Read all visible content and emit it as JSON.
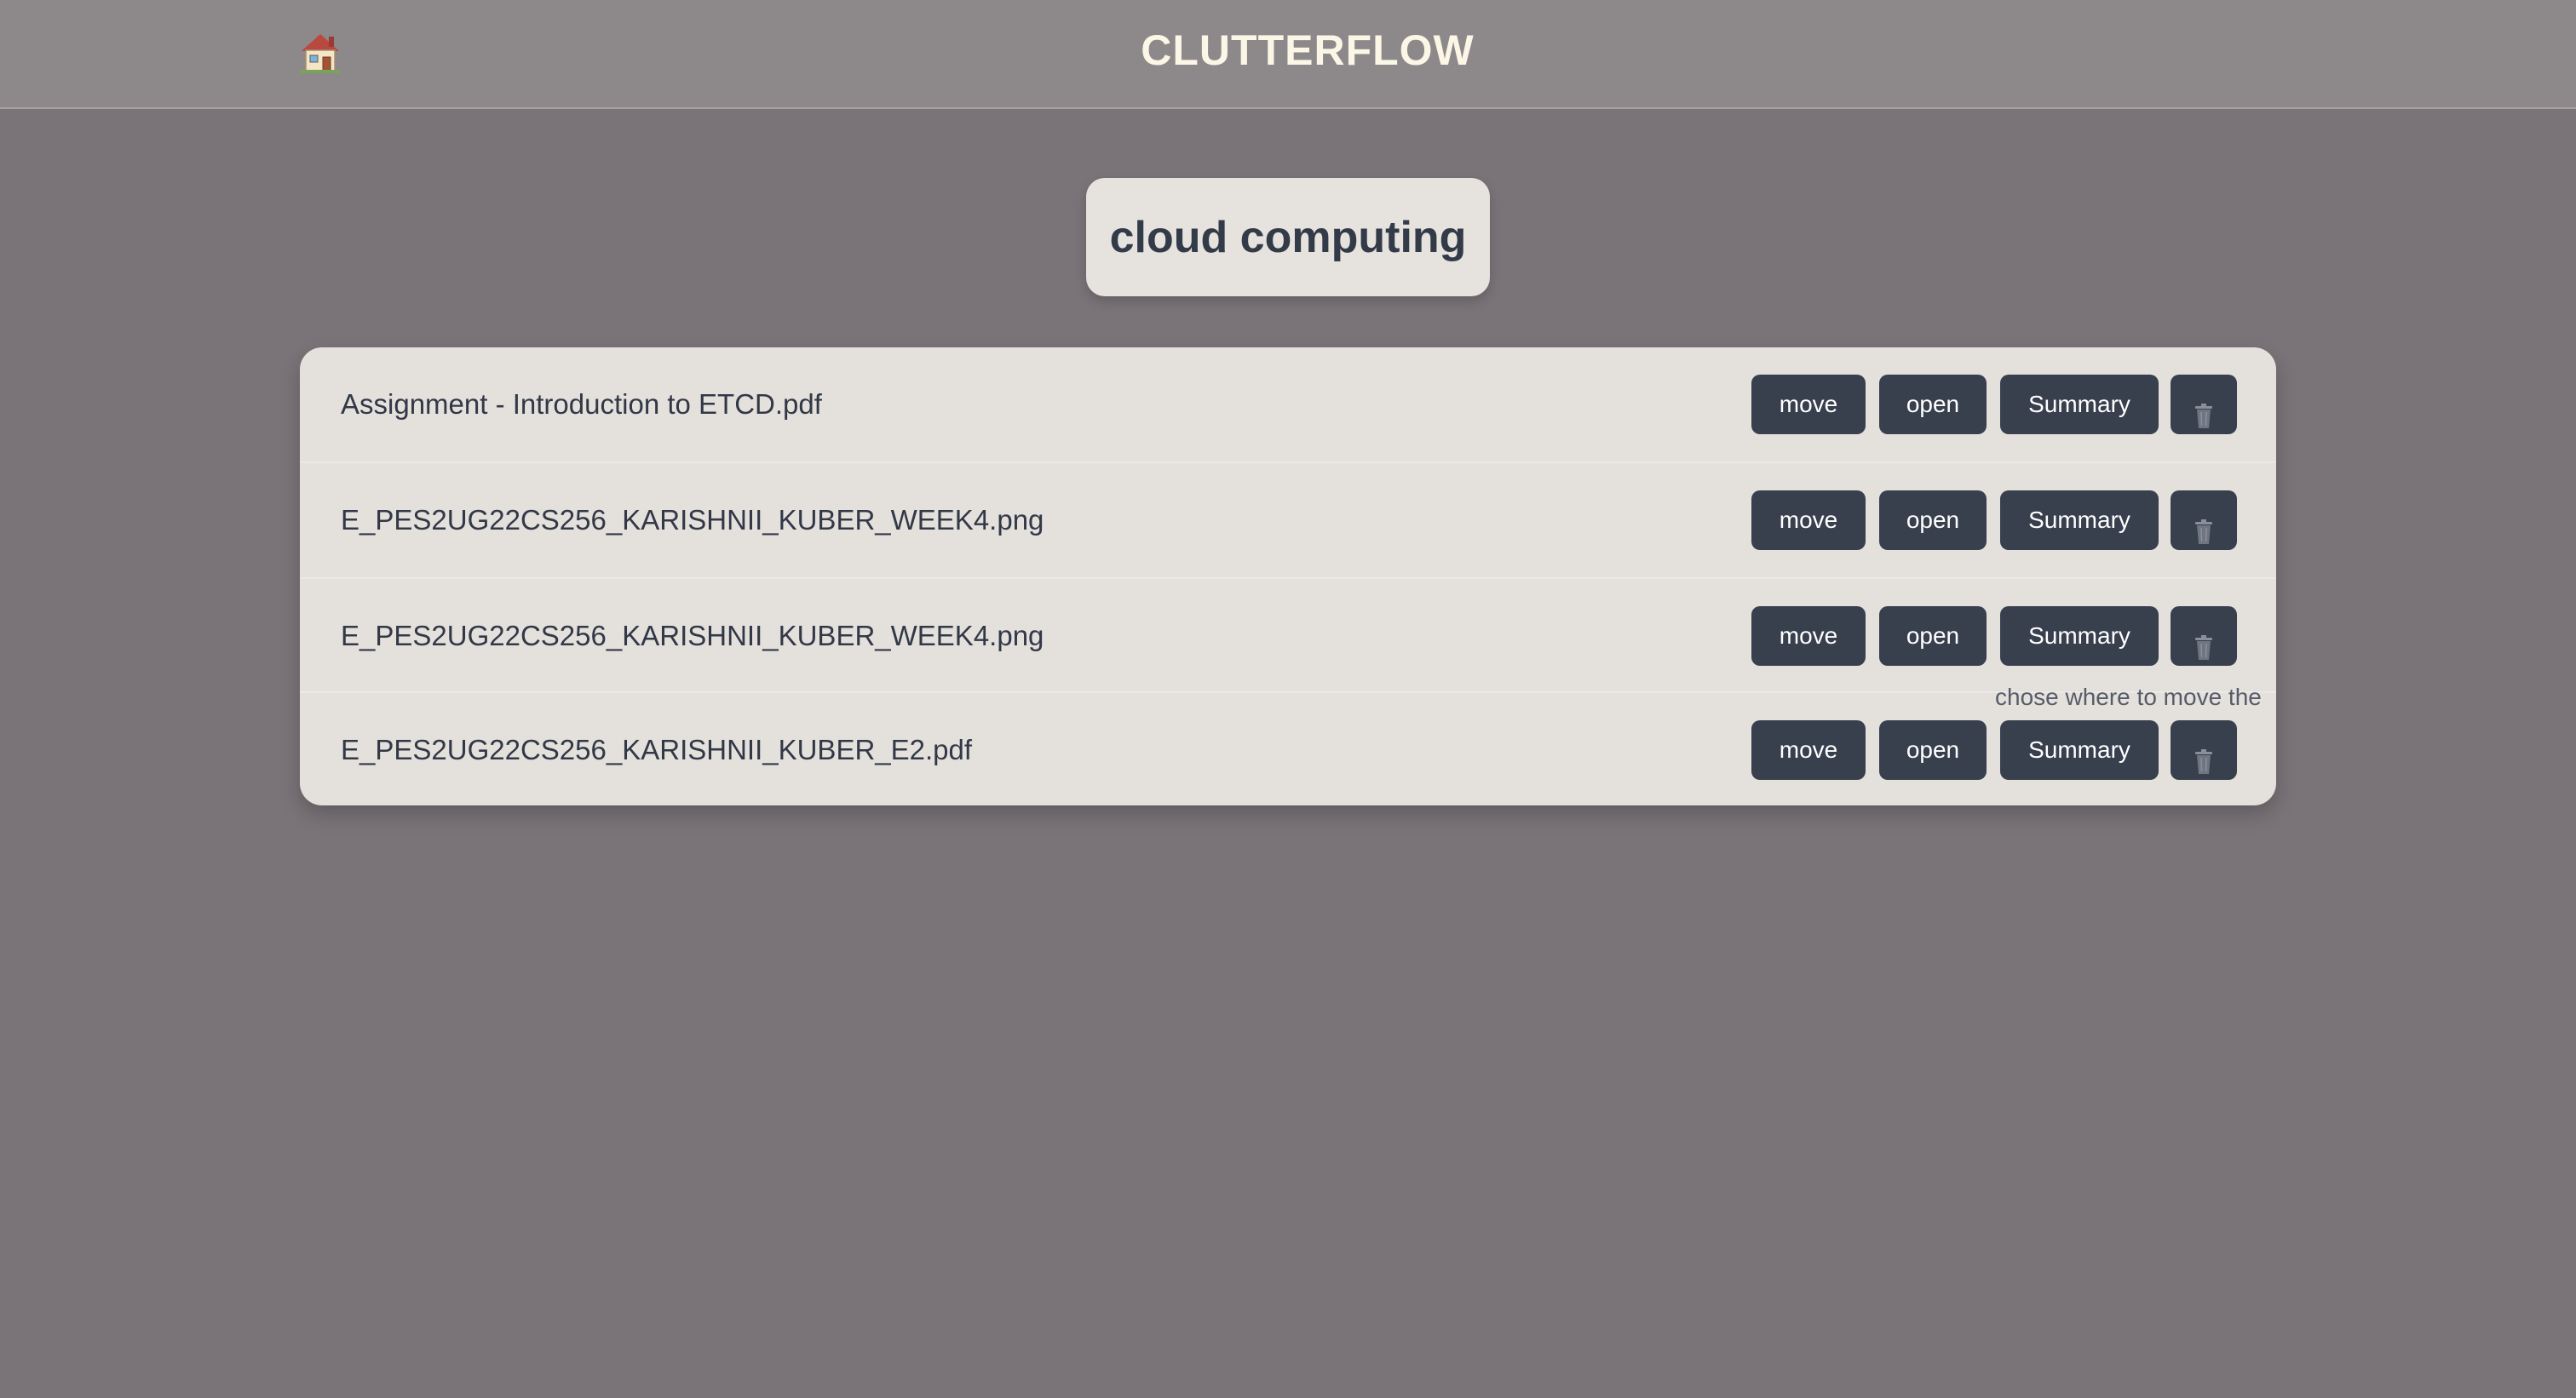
{
  "header": {
    "home_icon": "house-emoji",
    "app_title": "CLUTTERFLOW"
  },
  "folder": {
    "title": "cloud computing"
  },
  "files": [
    {
      "name": "Assignment - Introduction to ETCD.pdf",
      "move": "move",
      "open": "open",
      "summary": "Summary",
      "delete_icon": "trash-icon"
    },
    {
      "name": "E_PES2UG22CS256_KARISHNII_KUBER_WEEK4.png",
      "move": "move",
      "open": "open",
      "summary": "Summary",
      "delete_icon": "trash-icon"
    },
    {
      "name": "E_PES2UG22CS256_KARISHNII_KUBER_WEEK4.png",
      "move": "move",
      "open": "open",
      "summary": "Summary",
      "delete_icon": "trash-icon"
    },
    {
      "name": "E_PES2UG22CS256_KARISHNII_KUBER_E2.pdf",
      "move": "move",
      "open": "open",
      "summary": "Summary",
      "delete_icon": "trash-icon"
    }
  ],
  "tooltip": {
    "text": "chose where to move the"
  },
  "colors": {
    "background": "#7a7478",
    "header": "#8d888a",
    "card": "#e4e1dd",
    "button": "#383f4d",
    "title": "#fbf6e6"
  }
}
